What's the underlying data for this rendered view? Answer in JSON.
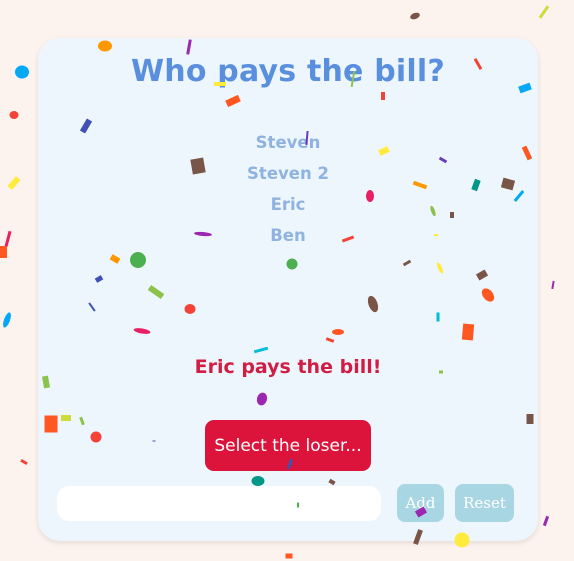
{
  "app": {
    "title": "Who pays the bill?",
    "participants": [
      "Steven",
      "Steven 2",
      "Eric",
      "Ben"
    ],
    "result_text": "Eric pays the bill!",
    "select_button_label": "Select the loser...",
    "name_input": {
      "value": "",
      "placeholder": ""
    },
    "add_button_label": "Add",
    "reset_button_label": "Reset"
  },
  "colors": {
    "background": "#fdf3ee",
    "card": "#eef6fd",
    "title": "#5a8fde",
    "names": "#8fb3e1",
    "result": "#cf1d43",
    "primary_button": "#dc143c",
    "secondary_button": "#a9d6e3"
  },
  "decoration": {
    "effect": "confetti"
  }
}
